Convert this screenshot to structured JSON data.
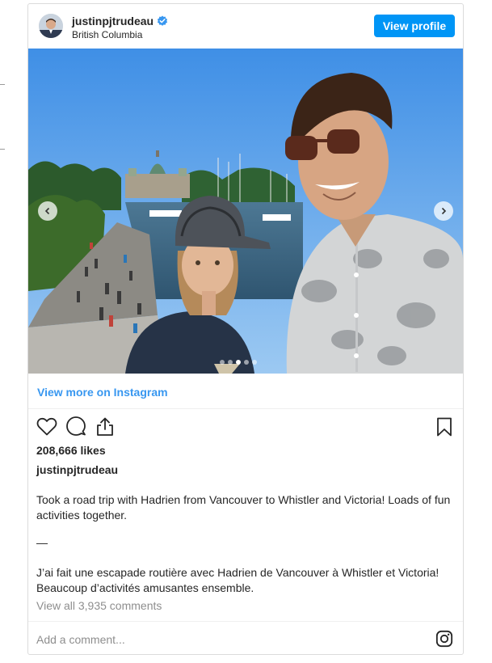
{
  "header": {
    "username": "justinpjtrudeau",
    "location": "British Columbia",
    "verified": true,
    "view_profile_label": "View profile"
  },
  "photo": {
    "carousel_dot_count": 5,
    "active_dot_index": 2
  },
  "view_more_label": "View more on Instagram",
  "actions": {
    "icons": [
      "heart-icon",
      "comment-icon",
      "share-icon",
      "bookmark-icon"
    ]
  },
  "likes_text": "208,666 likes",
  "caption": {
    "username": "justinpjtrudeau",
    "english": "Took a road trip with Hadrien from Vancouver to Whistler and Victoria! Loads of fun activities together.",
    "separator": "—",
    "french": "J’ai fait une escapade routière avec Hadrien de Vancouver à Whistler et Victoria! Beaucoup d’activités amusantes ensemble."
  },
  "comments_link": "View all 3,935 comments",
  "comment_input": {
    "placeholder": "Add a comment...",
    "value": ""
  },
  "colors": {
    "accent": "#0095f6",
    "link": "#3897f0",
    "muted": "#8e8e8e",
    "border": "#dbdbdb"
  }
}
